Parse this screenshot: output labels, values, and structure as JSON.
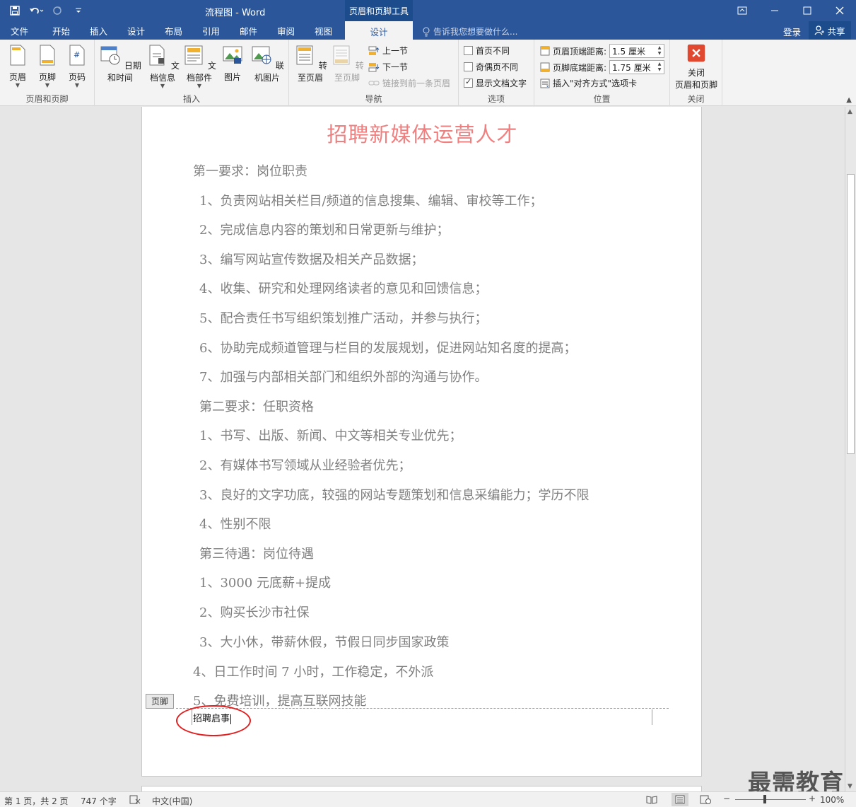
{
  "titlebar": {
    "doc_title": "流程图 - Word",
    "context_tool": "页眉和页脚工具"
  },
  "tabs": [
    {
      "label": "文件"
    },
    {
      "label": "开始"
    },
    {
      "label": "插入"
    },
    {
      "label": "设计"
    },
    {
      "label": "布局"
    },
    {
      "label": "引用"
    },
    {
      "label": "邮件"
    },
    {
      "label": "审阅"
    },
    {
      "label": "视图"
    },
    {
      "label": "设计",
      "active": true
    }
  ],
  "tellme": "告诉我您想要做什么...",
  "login": "登录",
  "share": "共享",
  "ribbon": {
    "group_headerfooter": {
      "label": "页眉和页脚",
      "header": "页眉",
      "footer": "页脚",
      "pagenum": "页码"
    },
    "group_insert": {
      "label": "插入",
      "datetime": "日期和时间",
      "docinfo": "文档信息",
      "quickparts": "文档部件",
      "picture": "图片",
      "online_picture": "联机图片"
    },
    "group_nav": {
      "label": "导航",
      "goto_header": "转至页眉",
      "goto_footer": "转至页脚",
      "prev": "上一节",
      "next": "下一节",
      "link_prev": "链接到前一条页眉"
    },
    "group_options": {
      "label": "选项",
      "diff_first": "首页不同",
      "diff_oddeven": "奇偶页不同",
      "show_text": "显示文档文字"
    },
    "group_position": {
      "label": "位置",
      "header_top": "页眉顶端距离:",
      "header_top_value": "1.5 厘米",
      "footer_bottom": "页脚底端距离:",
      "footer_bottom_value": "1.75 厘米",
      "insert_tab": "插入\"对齐方式\"选项卡"
    },
    "group_close": {
      "label": "关闭",
      "close_line1": "关闭",
      "close_line2": "页眉和页脚"
    }
  },
  "document": {
    "title": "招聘新媒体运营人才",
    "lines": [
      "第一要求：岗位职责",
      "1、负责网站相关栏目/频道的信息搜集、编辑、审校等工作；",
      "2、完成信息内容的策划和日常更新与维护；",
      "3、编写网站宣传数据及相关产品数据；",
      "4、收集、研究和处理网络读者的意见和回馈信息；",
      "5、配合责任书写组织策划推广活动，并参与执行；",
      "6、协助完成频道管理与栏目的发展规划，促进网站知名度的提高；",
      "7、加强与内部相关部门和组织外部的沟通与协作。",
      "第二要求：任职资格",
      "1、书写、出版、新闻、中文等相关专业优先；",
      "2、有媒体书写领域从业经验者优先；",
      "3、良好的文字功底，较强的网站专题策划和信息采编能力；学历不限",
      "4、性别不限",
      "第三待遇：岗位待遇",
      "1、3000 元底薪+提成",
      "2、购买长沙市社保",
      "3、大小休，带薪休假，节假日同步国家政策",
      "4、日工作时间 7 小时，工作稳定，不外派",
      "5、免费培训，提高互联网技能"
    ],
    "footer_tag": "页脚",
    "footer_text": "招聘启事"
  },
  "watermark": "最需教育",
  "statusbar": {
    "page": "第 1 页，共 2 页",
    "words": "747 个字",
    "language": "中文(中国)",
    "zoom": "100%"
  }
}
